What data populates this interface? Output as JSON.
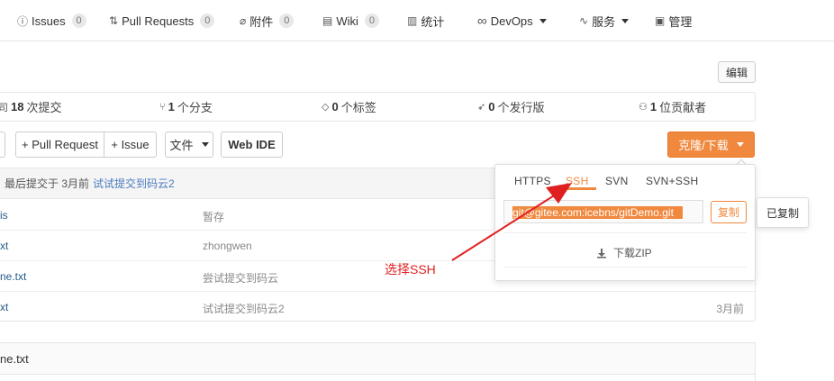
{
  "nav": {
    "issues": {
      "label": "Issues",
      "count": "0"
    },
    "pull_requests": {
      "label": "Pull Requests",
      "count": "0"
    },
    "attachments": {
      "label": "附件",
      "count": "0"
    },
    "wiki": {
      "label": "Wiki",
      "count": "0"
    },
    "stats": {
      "label": "统计"
    },
    "devops": {
      "label": "DevOps"
    },
    "services": {
      "label": "服务"
    },
    "manage": {
      "label": "管理"
    }
  },
  "edit_label": "编辑",
  "repo_stats": {
    "commits_count": "18",
    "commits_label": "次提交",
    "branches_count": "1",
    "branches_label": "个分支",
    "tags_count": "0",
    "tags_label": "个标签",
    "releases_count": "0",
    "releases_label": "个发行版",
    "contributors_count": "1",
    "contributors_label": "位贡献者"
  },
  "toolbar": {
    "pull_request": "+ Pull Request",
    "issue": "+ Issue",
    "file": "文件",
    "web_ide": "Web IDE",
    "clone": "克隆/下载"
  },
  "last_commit": {
    "prefix": "最后提交于 3月前",
    "message": "试试提交到码云2"
  },
  "files": [
    {
      "name": "is",
      "message": "暂存",
      "time": ""
    },
    {
      "name": "xt",
      "message": "zhongwen",
      "time": ""
    },
    {
      "name": "ne.txt",
      "message": "尝试提交到码云",
      "time": ""
    },
    {
      "name": "xt",
      "message": "试试提交到码云2",
      "time": "3月前"
    }
  ],
  "readme": {
    "title": "ne.txt"
  },
  "clone_popup": {
    "tabs": [
      "HTTPS",
      "SSH",
      "SVN",
      "SVN+SSH"
    ],
    "active_tab": "SSH",
    "url": "git@gitee.com:icebns/gitDemo.git",
    "copy_label": "复制",
    "download_zip": "下载ZIP"
  },
  "tooltip": "已复制",
  "annotation": "选择SSH",
  "colors": {
    "accent": "#f0883e",
    "annotation": "#e02020",
    "link": "#245c8a"
  }
}
